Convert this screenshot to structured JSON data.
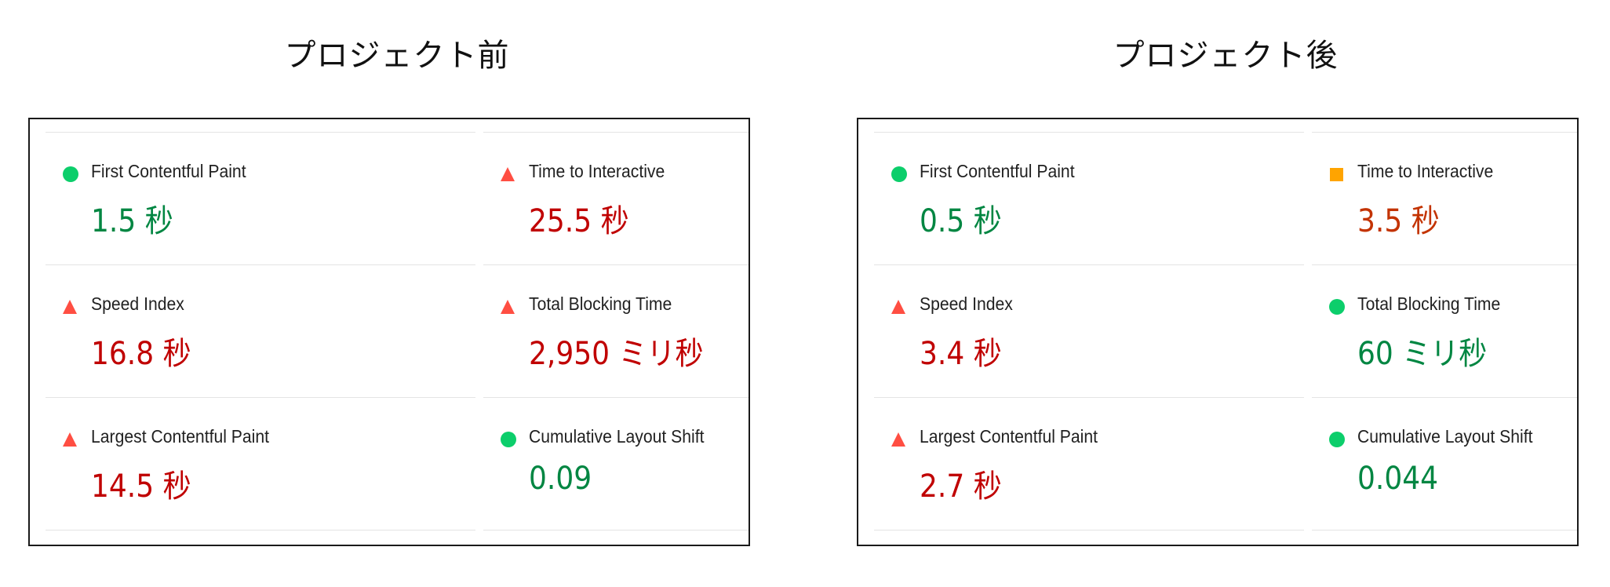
{
  "before": {
    "title": "プロジェクト前",
    "metrics": [
      {
        "label": "First Contentful Paint",
        "value": "1.5 秒",
        "status": "pass"
      },
      {
        "label": "Speed Index",
        "value": "16.8 秒",
        "status": "fail"
      },
      {
        "label": "Largest Contentful Paint",
        "value": "14.5 秒",
        "status": "fail"
      },
      {
        "label": "Time to Interactive",
        "value": "25.5 秒",
        "status": "fail"
      },
      {
        "label": "Total Blocking Time",
        "value": "2,950 ミリ秒",
        "status": "fail"
      },
      {
        "label": "Cumulative Layout Shift",
        "value": "0.09",
        "status": "pass"
      }
    ]
  },
  "after": {
    "title": "プロジェクト後",
    "metrics": [
      {
        "label": "First Contentful Paint",
        "value": "0.5 秒",
        "status": "pass"
      },
      {
        "label": "Speed Index",
        "value": "3.4 秒",
        "status": "fail"
      },
      {
        "label": "Largest Contentful Paint",
        "value": "2.7 秒",
        "status": "fail"
      },
      {
        "label": "Time to Interactive",
        "value": "3.5 秒",
        "status": "average"
      },
      {
        "label": "Total Blocking Time",
        "value": "60 ミリ秒",
        "status": "pass"
      },
      {
        "label": "Cumulative Layout Shift",
        "value": "0.044",
        "status": "pass"
      }
    ]
  },
  "colors": {
    "pass_icon": "#0cce6b",
    "fail_icon": "#ff4e42",
    "average_icon": "#ffa400",
    "pass_text": "#018642",
    "fail_text": "#c00000",
    "average_text": "#c33300"
  }
}
